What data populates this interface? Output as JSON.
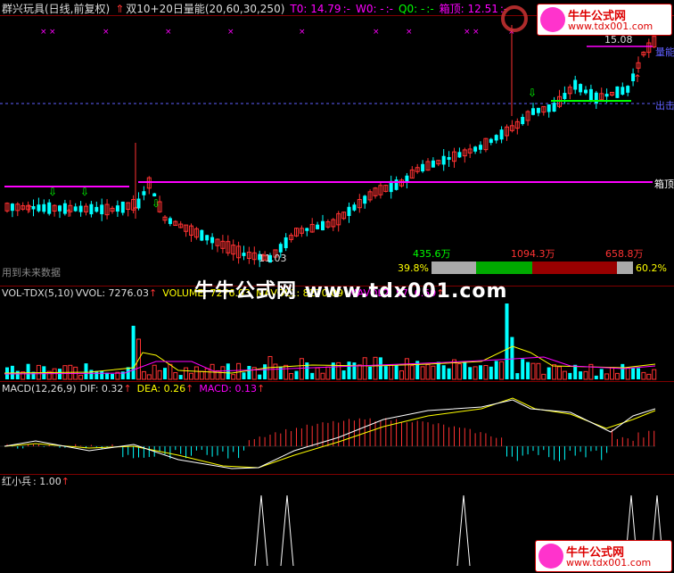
{
  "header": {
    "stock": "群兴玩具(日线,前复权)",
    "indicator": "双10+20日量能",
    "params": "(20,60,30,250)",
    "t0": "T0: 14.79",
    "t0_sep": ":-",
    "w0": "W0: -",
    "w0_sep": ":-",
    "q0": "Q0: -",
    "q0_sep": ":-",
    "box_top": "箱顶: 12.51",
    "box_top_sep": ":-"
  },
  "main_chart": {
    "price_high_label": "15.08",
    "price_low_label": "11.03",
    "low_label": "11.03",
    "right_label_top": "量能",
    "right_label_mid": "出击",
    "right_label_box": "箱顶",
    "future_data_label": "用到未来数据",
    "colors": {
      "up": "#ff3232",
      "down": "#00ffff",
      "box": "#ff00ff",
      "exit": "#6060ff"
    }
  },
  "volume_bar": {
    "val_a": "435.6万",
    "val_b": "1094.3万",
    "val_c": "658.8万",
    "pct_left": "39.8%",
    "pct_right": "60.2%"
  },
  "vol_panel": {
    "title": "VOL-TDX(5,10)",
    "vvol": "VVOL: 7276.03",
    "volume": "VOLUME: 7276.03",
    "mavol1": "MAVOL1: 8270.09",
    "mavol2": "MAVOL2: 5716.59"
  },
  "macd_panel": {
    "title": "MACD(12,26,9)",
    "dif": "DIF: 0.32",
    "dea": "DEA: 0.26",
    "macd": "MACD: 0.13"
  },
  "hxb_panel": {
    "title": "红小兵",
    "value": ": 1.00"
  },
  "watermark": {
    "center": "牛牛公式网 www.tdx001.com",
    "badge_title": "牛牛公式网",
    "badge_url": "www.tdx001.com"
  }
}
